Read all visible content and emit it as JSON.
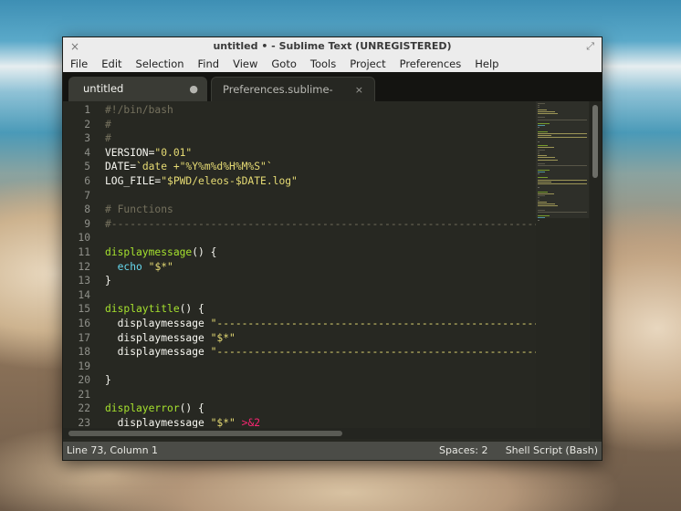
{
  "window": {
    "title": "untitled • - Sublime Text (UNREGISTERED)",
    "close_glyph": "×",
    "maximize_glyph": "⤢"
  },
  "menu": [
    "File",
    "Edit",
    "Selection",
    "Find",
    "View",
    "Goto",
    "Tools",
    "Project",
    "Preferences",
    "Help"
  ],
  "tabs": [
    {
      "label": "untitled",
      "indicator": "●",
      "active": true
    },
    {
      "label": "Preferences.sublime-settings",
      "indicator": "×",
      "active": false
    }
  ],
  "editor": {
    "line_numbers": [
      "1",
      "2",
      "3",
      "4",
      "5",
      "6",
      "7",
      "8",
      "9",
      "10",
      "11",
      "12",
      "13",
      "14",
      "15",
      "16",
      "17",
      "18",
      "19",
      "20",
      "21",
      "22",
      "23"
    ],
    "lines": [
      [
        {
          "t": "#!/bin/bash",
          "c": "com"
        }
      ],
      [
        {
          "t": "#",
          "c": "com"
        }
      ],
      [
        {
          "t": "#",
          "c": "com"
        }
      ],
      [
        {
          "t": "VERSION=",
          "c": ""
        },
        {
          "t": "\"0.01\"",
          "c": "str"
        }
      ],
      [
        {
          "t": "DATE=",
          "c": ""
        },
        {
          "t": "`date +\"%Y%m%d%H%M%S\"`",
          "c": "str"
        }
      ],
      [
        {
          "t": "LOG_FILE=",
          "c": ""
        },
        {
          "t": "\"$PWD/eleos-$DATE.log\"",
          "c": "str"
        }
      ],
      [
        {
          "t": "",
          "c": ""
        }
      ],
      [
        {
          "t": "# Functions",
          "c": "com"
        }
      ],
      [
        {
          "t": "#--------------------------------------------------------------------------------",
          "c": "com"
        }
      ],
      [
        {
          "t": "",
          "c": ""
        }
      ],
      [
        {
          "t": "displaymessage",
          "c": "fn"
        },
        {
          "t": "() {",
          "c": ""
        }
      ],
      [
        {
          "t": "  ",
          "c": ""
        },
        {
          "t": "echo",
          "c": "kw"
        },
        {
          "t": " ",
          "c": ""
        },
        {
          "t": "\"$*\"",
          "c": "str"
        }
      ],
      [
        {
          "t": "}",
          "c": ""
        }
      ],
      [
        {
          "t": "",
          "c": ""
        }
      ],
      [
        {
          "t": "displaytitle",
          "c": "fn"
        },
        {
          "t": "() {",
          "c": ""
        }
      ],
      [
        {
          "t": "  displaymessage ",
          "c": ""
        },
        {
          "t": "\"--------------------------------------------------------------------------\"",
          "c": "str"
        }
      ],
      [
        {
          "t": "  displaymessage ",
          "c": ""
        },
        {
          "t": "\"$*\"",
          "c": "str"
        }
      ],
      [
        {
          "t": "  displaymessage ",
          "c": ""
        },
        {
          "t": "\"--------------------------------------------------------------------------\"",
          "c": "str"
        }
      ],
      [
        {
          "t": "",
          "c": ""
        }
      ],
      [
        {
          "t": "}",
          "c": ""
        }
      ],
      [
        {
          "t": "",
          "c": ""
        }
      ],
      [
        {
          "t": "displayerror",
          "c": "fn"
        },
        {
          "t": "() {",
          "c": ""
        }
      ],
      [
        {
          "t": "  displaymessage ",
          "c": ""
        },
        {
          "t": "\"$*\"",
          "c": "str"
        },
        {
          "t": " ",
          "c": ""
        },
        {
          "t": ">&2",
          "c": "op"
        }
      ]
    ]
  },
  "status": {
    "position": "Line 73, Column 1",
    "spaces": "Spaces: 2",
    "syntax": "Shell Script (Bash)"
  },
  "colors": {
    "background": "#272822",
    "comment": "#75715e",
    "string": "#e6db74",
    "function": "#a6e22e",
    "keyword": "#66d9ef",
    "operator": "#f92672"
  }
}
